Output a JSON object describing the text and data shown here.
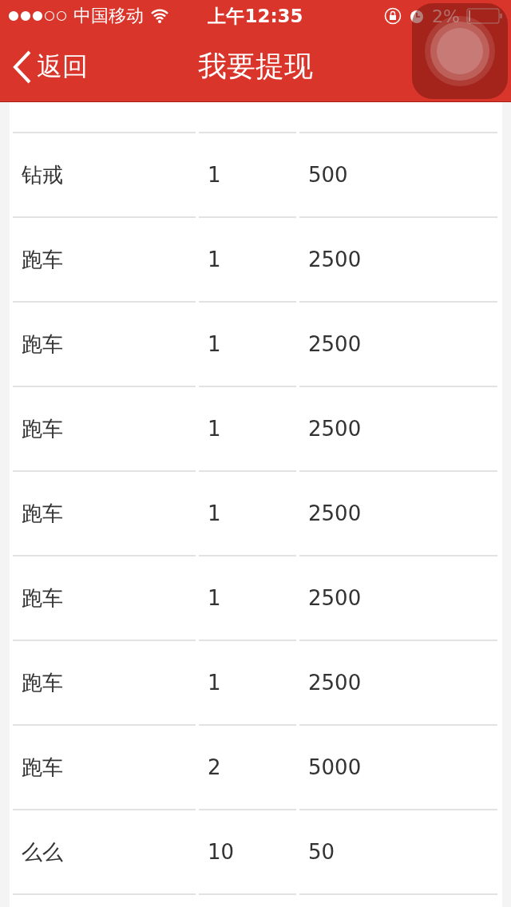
{
  "status_bar": {
    "carrier": "中国移动",
    "time": "上午12:35",
    "battery": "2%"
  },
  "nav_bar": {
    "back": "返回",
    "title": "我要提现"
  },
  "table": {
    "rows": [
      {
        "cells": [
          "钻戒",
          "1",
          "500"
        ]
      },
      {
        "cells": [
          "跑车",
          "1",
          "2500"
        ]
      },
      {
        "cells": [
          "跑车",
          "1",
          "2500"
        ]
      },
      {
        "cells": [
          "跑车",
          "1",
          "2500"
        ]
      },
      {
        "cells": [
          "跑车",
          "1",
          "2500"
        ]
      },
      {
        "cells": [
          "跑车",
          "1",
          "2500"
        ]
      },
      {
        "cells": [
          "跑车",
          "1",
          "2500"
        ]
      },
      {
        "cells": [
          "跑车",
          "2",
          "5000"
        ]
      },
      {
        "cells": [
          "么么",
          "10",
          "50"
        ]
      }
    ]
  }
}
